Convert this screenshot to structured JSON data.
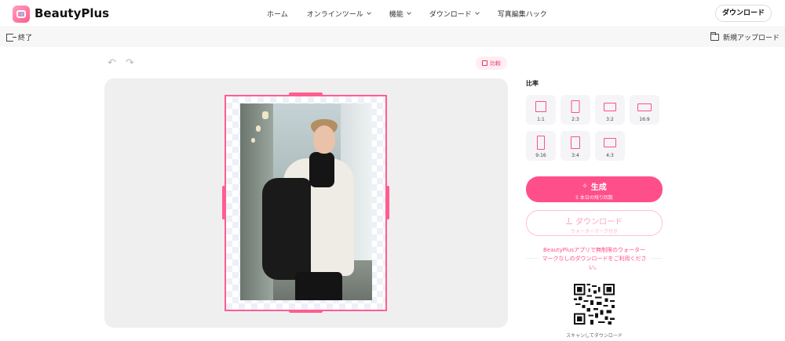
{
  "header": {
    "brand": "BeautyPlus",
    "nav": [
      {
        "label": "ホーム",
        "has_dropdown": false
      },
      {
        "label": "オンラインツール",
        "has_dropdown": true
      },
      {
        "label": "機能",
        "has_dropdown": true
      },
      {
        "label": "ダウンロード",
        "has_dropdown": true
      },
      {
        "label": "写真編集ハック",
        "has_dropdown": false
      }
    ],
    "download_button": "ダウンロード"
  },
  "subbar": {
    "exit_label": "終了",
    "new_upload_label": "新規アップロード"
  },
  "toolbar": {
    "undo_icon": "undo-icon",
    "redo_icon": "redo-icon",
    "compare_label": "比較"
  },
  "panel": {
    "ratio_title": "比率",
    "ratios": [
      {
        "label": "1:1",
        "w": 1,
        "h": 1
      },
      {
        "label": "2:3",
        "w": 2,
        "h": 3
      },
      {
        "label": "3:2",
        "w": 3,
        "h": 2
      },
      {
        "label": "16:9",
        "w": 16,
        "h": 9
      },
      {
        "label": "9:16",
        "w": 9,
        "h": 16
      },
      {
        "label": "3:4",
        "w": 3,
        "h": 4
      },
      {
        "label": "4:3",
        "w": 4,
        "h": 3
      }
    ],
    "generate_label": "生成",
    "generate_sub": "5 本日の残り回数",
    "download_label": "ダウンロード",
    "download_sub": "ウォーターマーク付き",
    "promo_text": "BeautyPlusアプリで無制限のウォーターマークなしのダウンロードをご利用ください。",
    "qr_caption": "スキャンしてダウンロード"
  },
  "colors": {
    "accent": "#ff4f8a",
    "accent_light": "#ffc1d4",
    "canvas_bg": "#efefef"
  }
}
